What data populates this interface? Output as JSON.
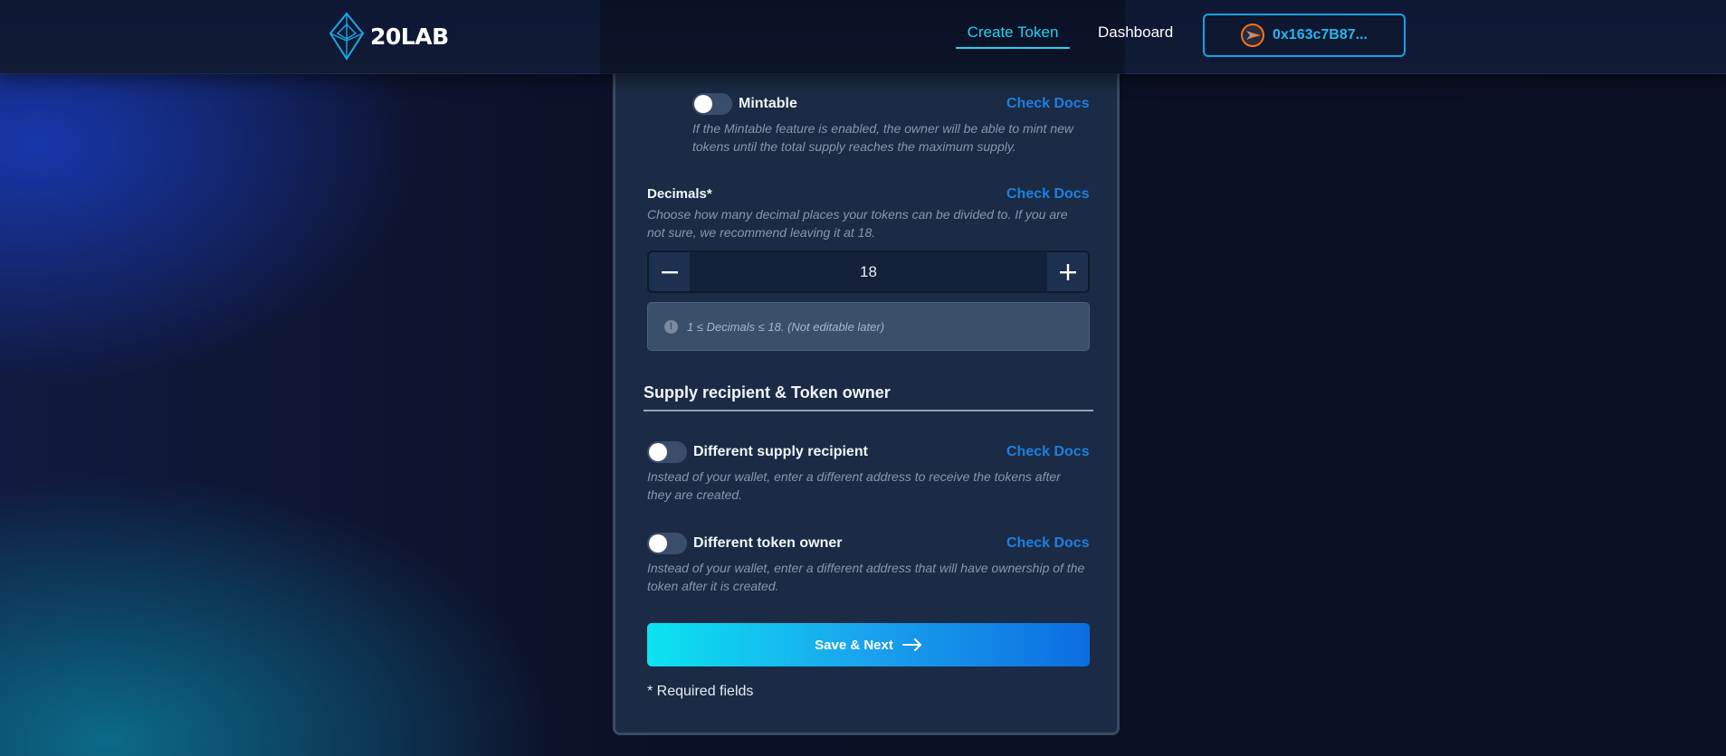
{
  "header": {
    "logo_text": "20LAB",
    "nav": [
      {
        "label": "Create Token",
        "active": true
      },
      {
        "label": "Dashboard",
        "active": false
      }
    ],
    "wallet_address": "0x163c7B87..."
  },
  "form": {
    "mintable": {
      "label": "Mintable",
      "enabled": false,
      "docs_link": "Check Docs",
      "description": "If the Mintable feature is enabled, the owner will be able to mint new tokens until the total supply reaches the maximum supply."
    },
    "decimals": {
      "label": "Decimals*",
      "docs_link": "Check Docs",
      "description": "Choose how many decimal places your tokens can be divided to. If you are not sure, we recommend leaving it at 18.",
      "value": "18",
      "note": "1 ≤ Decimals ≤ 18. (Not editable later)"
    },
    "section_title": "Supply recipient & Token owner",
    "supply_recipient": {
      "label": "Different supply recipient",
      "enabled": false,
      "docs_link": "Check Docs",
      "description": "Instead of your wallet, enter a different address to receive the tokens after they are created."
    },
    "token_owner": {
      "label": "Different token owner",
      "enabled": false,
      "docs_link": "Check Docs",
      "description": "Instead of your wallet, enter a different address that will have ownership of the token after it is created."
    },
    "save_label": "Save & Next",
    "required_note": "* Required fields"
  },
  "colors": {
    "accent": "#22d3ee",
    "link": "#1c7fe0",
    "card_bg": "#1b2b45"
  }
}
